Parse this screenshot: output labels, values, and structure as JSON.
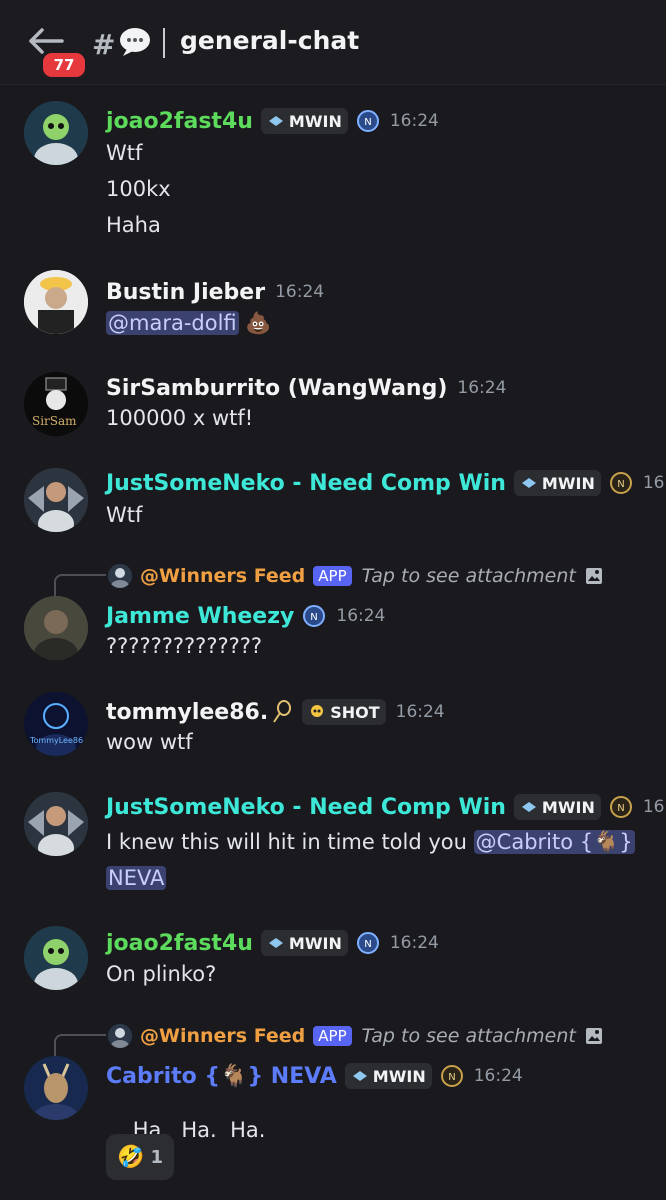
{
  "header": {
    "badge_count": "77",
    "hash": "#",
    "channel_name": "general-chat"
  },
  "reply_common": {
    "app_label": "APP",
    "tap_text": "Tap to see attachment"
  },
  "messages": [
    {
      "author": "joao2fast4u",
      "tag": "MWIN",
      "time": "16:24",
      "lines": [
        "Wtf",
        "100kx",
        "Haha"
      ]
    },
    {
      "author": "Bustin Jieber",
      "time": "16:24",
      "mention": "@mara-dolfi",
      "emoji": "💩"
    },
    {
      "author": "SirSamburrito (WangWang)",
      "time": "16:24",
      "avatar_text": "SirSam",
      "lines": [
        "100000 x wtf!"
      ]
    },
    {
      "author": "JustSomeNeko - Need Comp Win",
      "tag": "MWIN",
      "time": "16:24",
      "lines": [
        "Wtf"
      ]
    },
    {
      "reply_to": "@Winners Feed",
      "author": "Jamme Wheezy",
      "time": "16:24",
      "lines": [
        "??????????????"
      ]
    },
    {
      "author": "tommylee86.",
      "tag": "SHOT",
      "time": "16:24",
      "avatar_text": "TommyLee86",
      "lines": [
        "wow wtf"
      ]
    },
    {
      "author": "JustSomeNeko - Need Comp Win",
      "tag": "MWIN",
      "time": "16:24",
      "text": "I knew this will hit in time told you",
      "mention_1": "@Cabrito {🐐}",
      "mention_2": "NEVA"
    },
    {
      "author": "joao2fast4u",
      "tag": "MWIN",
      "time": "16:24",
      "lines": [
        "On plinko?"
      ]
    },
    {
      "reply_to": "@Winners Feed",
      "author": "Cabrito {🐐} NEVA",
      "tag": "MWIN",
      "time": "16:24",
      "text": "Ha.  Ha.  Ha.",
      "emoji": "😢",
      "reaction_emoji": "🤣",
      "reaction_count": "1"
    }
  ],
  "colors": {
    "green": "#5cdb5c",
    "cyan": "#3ee8d8",
    "blue": "#5c7cfa",
    "white": "#f2f3f5",
    "reply": "#f0a042"
  }
}
